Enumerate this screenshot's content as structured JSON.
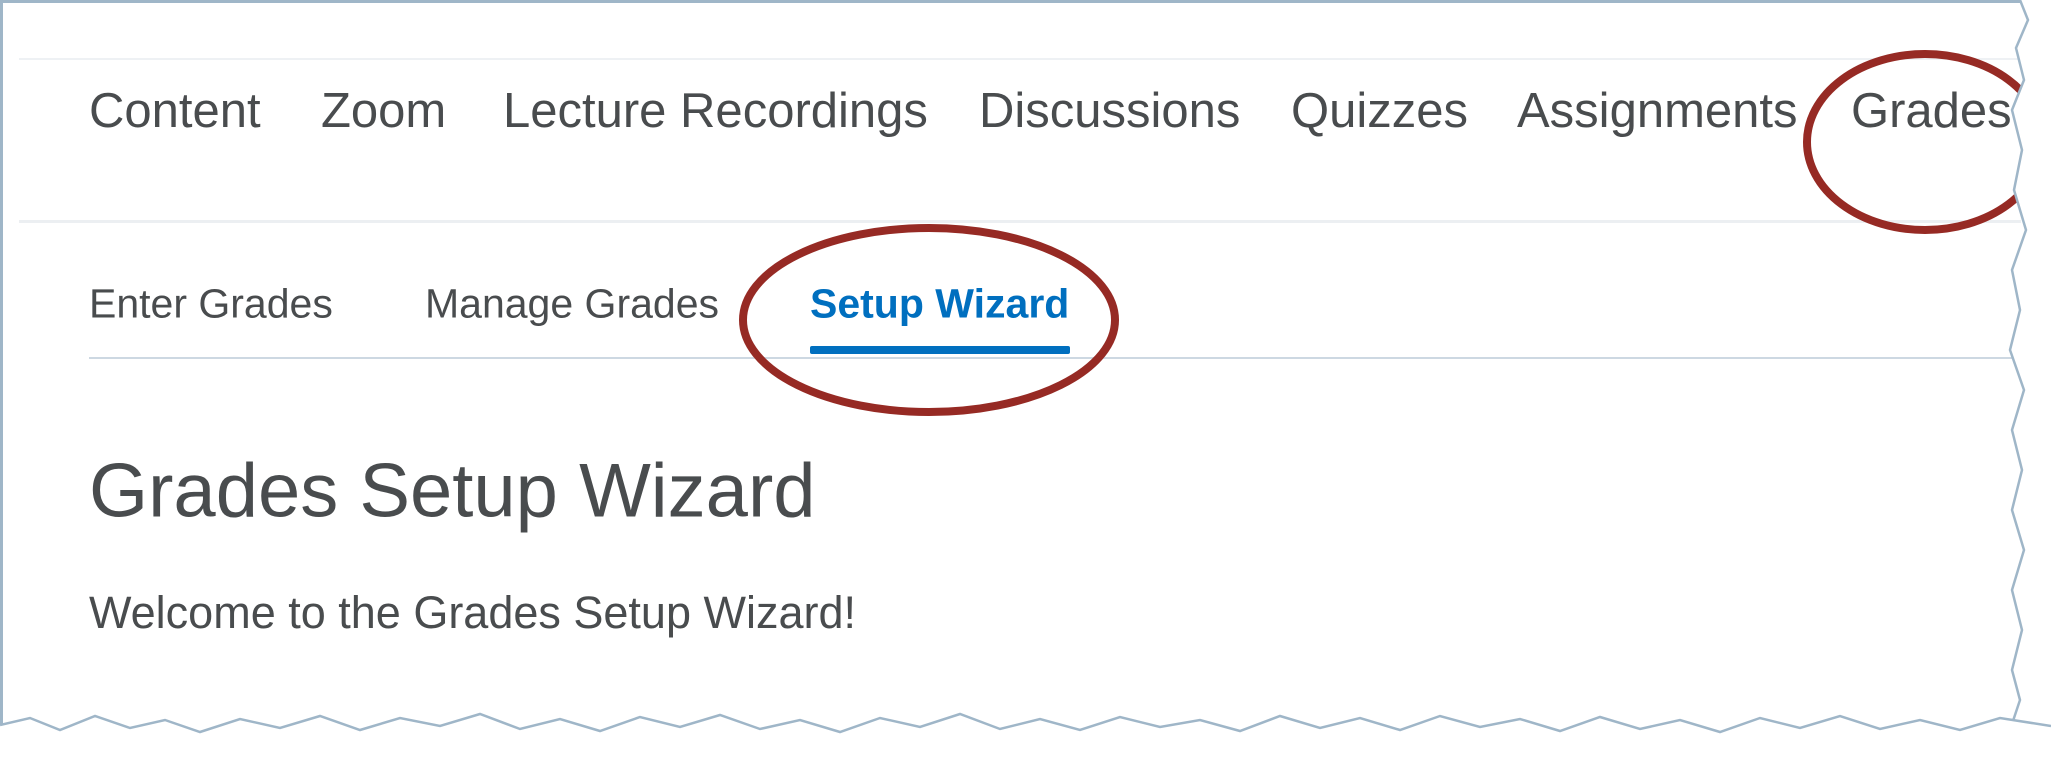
{
  "nav": {
    "items": [
      {
        "label": "Content"
      },
      {
        "label": "Zoom"
      },
      {
        "label": "Lecture Recordings"
      },
      {
        "label": "Discussions"
      },
      {
        "label": "Quizzes"
      },
      {
        "label": "Assignments"
      },
      {
        "label": "Grades"
      }
    ]
  },
  "subnav": {
    "items": [
      {
        "label": "Enter Grades"
      },
      {
        "label": "Manage Grades"
      },
      {
        "label": "Setup Wizard",
        "active": true
      }
    ]
  },
  "main": {
    "title": "Grades Setup Wizard",
    "welcome": "Welcome to the Grades Setup Wizard!"
  },
  "colors": {
    "accent": "#006fbf",
    "text": "#494c4e",
    "annotation": "#962a24"
  }
}
